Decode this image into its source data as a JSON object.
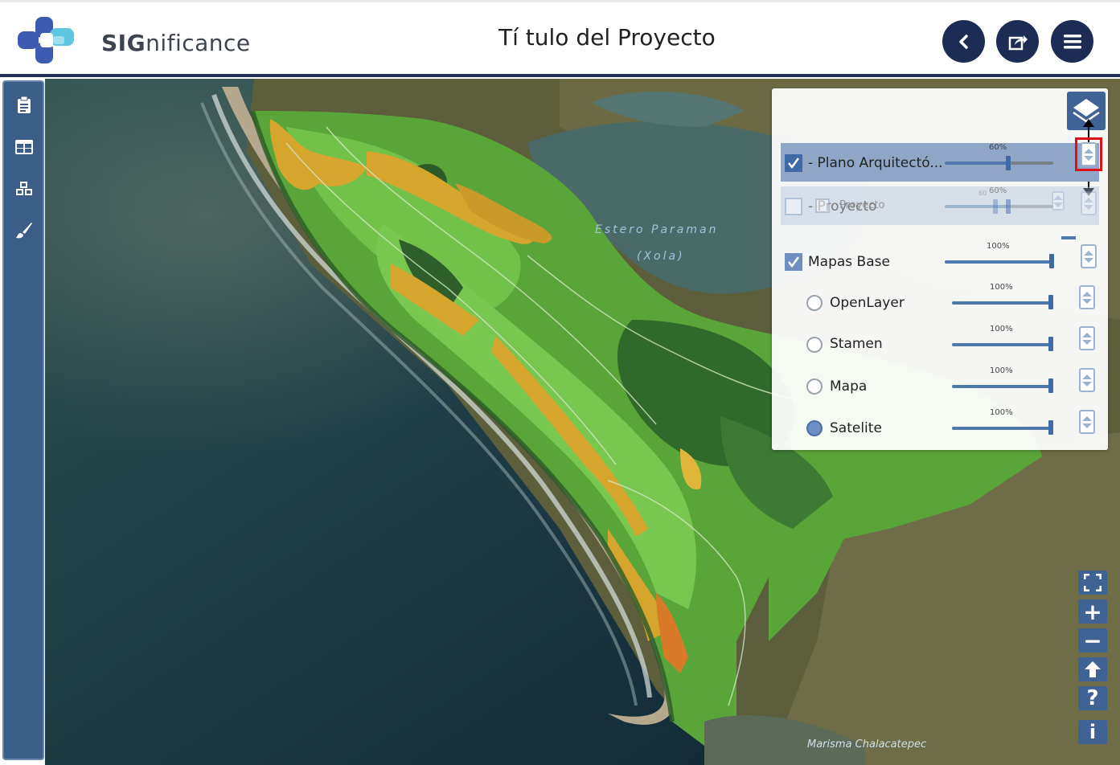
{
  "app": {
    "logo_bold": "SIG",
    "logo_rest": "nificance",
    "title": "Tí tulo del Proyecto"
  },
  "header_buttons": [
    {
      "name": "back-icon"
    },
    {
      "name": "share-icon"
    },
    {
      "name": "menu-icon"
    }
  ],
  "sidebar": {
    "items": [
      {
        "icon": "clipboard-icon"
      },
      {
        "icon": "table-icon"
      },
      {
        "icon": "cubes-icon"
      },
      {
        "icon": "brush-icon"
      }
    ]
  },
  "map": {
    "labels": {
      "estero": "Estero Paraman",
      "xola": "(Xola)",
      "marisma": "Marisma Chalacatepec"
    }
  },
  "layer_panel": {
    "layers": [
      {
        "name": "- Plano Arquitectó...",
        "opacity_label": "60%",
        "opacity": 0.6,
        "checked": true
      },
      {
        "name": "- Proyecto",
        "opacity_label": "60%",
        "opacity": 0.6,
        "checked": false,
        "ghost_overlay": "Proyecto",
        "ghost_prefix": "60"
      }
    ],
    "base_maps": {
      "name": "Mapas Base",
      "opacity_label": "100%",
      "opacity": 1.0,
      "checked": true,
      "options": [
        {
          "name": "OpenLayer",
          "opacity_label": "100%",
          "selected": false
        },
        {
          "name": "Stamen",
          "opacity_label": "100%",
          "selected": false
        },
        {
          "name": "Mapa",
          "opacity_label": "100%",
          "selected": false
        },
        {
          "name": "Satelite",
          "opacity_label": "100%",
          "selected": true
        }
      ]
    }
  },
  "map_controls": [
    {
      "name": "fullscreen-icon"
    },
    {
      "name": "zoom-in-icon",
      "label": "+"
    },
    {
      "name": "zoom-out-icon",
      "label": "−"
    },
    {
      "name": "arrow-up-icon"
    },
    {
      "name": "help-icon",
      "label": "?"
    },
    {
      "name": "info-icon",
      "label": "i"
    }
  ],
  "colors": {
    "header_dark": "#1c2c55",
    "sidebar": "#3b5e88",
    "accent": "#3f6394",
    "highlight": "#e0101a"
  }
}
